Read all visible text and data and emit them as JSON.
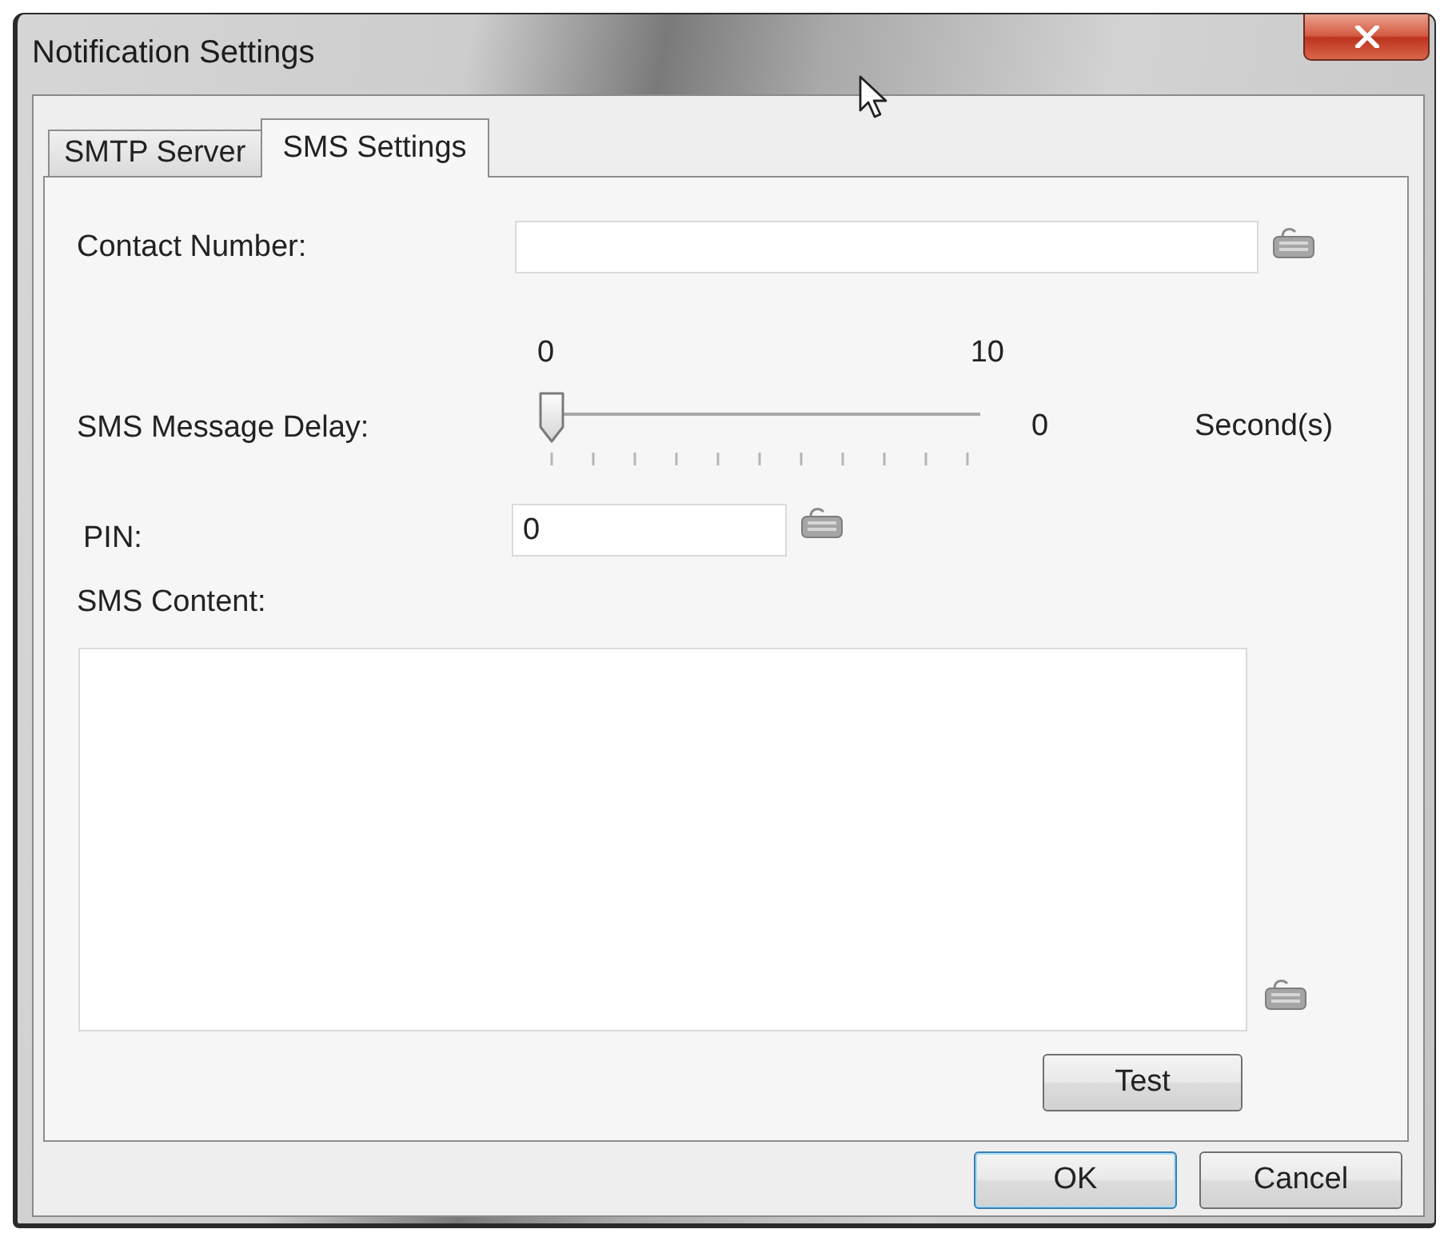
{
  "window": {
    "title": "Notification Settings"
  },
  "tabs": [
    {
      "label": "SMTP Server",
      "selected": false
    },
    {
      "label": "SMS Settings",
      "selected": true
    }
  ],
  "contact_number": {
    "label": "Contact Number:"
  },
  "message_delay": {
    "label": "SMS Message Delay:",
    "min_label": "0",
    "max_label": "10",
    "level": 0,
    "reading": "0",
    "unit": "Second(s)"
  },
  "pin": {
    "label": "PIN:",
    "value": "0"
  },
  "sms_content": {
    "label": "SMS Content:"
  },
  "test_button": {
    "label": "Test"
  },
  "buttons": [
    {
      "label": "OK",
      "default": true
    },
    {
      "label": "Cancel",
      "default": false
    }
  ]
}
